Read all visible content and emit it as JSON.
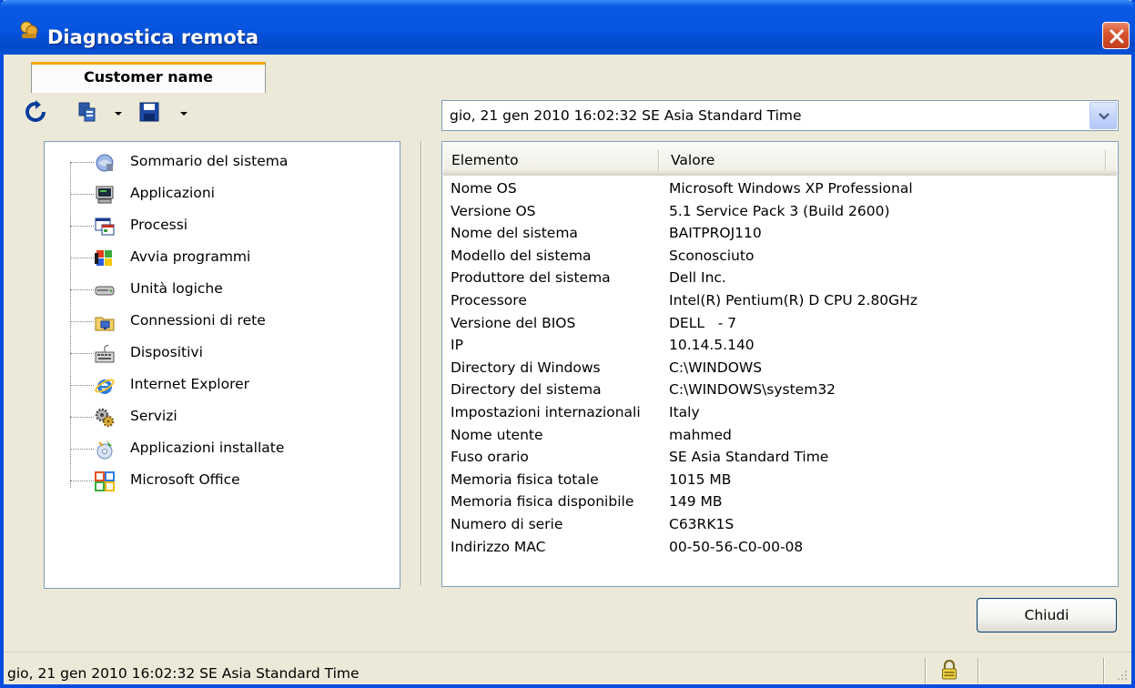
{
  "window": {
    "title": "Diagnostica remota",
    "close_label": "×"
  },
  "tab": {
    "label": "Customer name"
  },
  "toolbar": {
    "icons": [
      "refresh-icon",
      "copy-icon",
      "save-icon"
    ]
  },
  "tree": {
    "items": [
      {
        "label": "Sommario del sistema",
        "icon": "system-summary-icon"
      },
      {
        "label": "Applicazioni",
        "icon": "applications-icon"
      },
      {
        "label": "Processi",
        "icon": "processes-icon"
      },
      {
        "label": "Avvia programmi",
        "icon": "startup-programs-icon"
      },
      {
        "label": "Unità logiche",
        "icon": "logical-drives-icon"
      },
      {
        "label": "Connessioni di rete",
        "icon": "network-connections-icon"
      },
      {
        "label": "Dispositivi",
        "icon": "devices-icon"
      },
      {
        "label": "Internet Explorer",
        "icon": "internet-explorer-icon"
      },
      {
        "label": "Servizi",
        "icon": "services-icon"
      },
      {
        "label": "Applicazioni installate",
        "icon": "installed-apps-icon"
      },
      {
        "label": "Microsoft Office",
        "icon": "microsoft-office-icon"
      }
    ]
  },
  "date_select": {
    "value": "gio, 21 gen 2010 16:02:32 SE Asia Standard Time"
  },
  "list": {
    "headers": {
      "element": "Elemento",
      "value": "Valore"
    },
    "rows": [
      {
        "k": "Nome OS",
        "v": "Microsoft Windows XP Professional"
      },
      {
        "k": "Versione OS",
        "v": "5.1 Service Pack 3 (Build 2600)"
      },
      {
        "k": "Nome del sistema",
        "v": "BAITPROJ110"
      },
      {
        "k": "Modello del sistema",
        "v": "Sconosciuto"
      },
      {
        "k": "Produttore del sistema",
        "v": "Dell Inc."
      },
      {
        "k": "Processore",
        "v": "Intel(R) Pentium(R) D CPU 2.80GHz"
      },
      {
        "k": "Versione del BIOS",
        "v": "DELL   - 7"
      },
      {
        "k": "IP",
        "v": "10.14.5.140"
      },
      {
        "k": "Directory di Windows",
        "v": "C:\\WINDOWS"
      },
      {
        "k": "Directory del sistema",
        "v": "C:\\WINDOWS\\system32"
      },
      {
        "k": "Impostazioni internazionali",
        "v": "Italy"
      },
      {
        "k": "Nome utente",
        "v": "mahmed"
      },
      {
        "k": "Fuso orario",
        "v": "SE Asia Standard Time"
      },
      {
        "k": "Memoria fisica totale",
        "v": "1015 MB"
      },
      {
        "k": "Memoria fisica disponibile",
        "v": "149 MB"
      },
      {
        "k": "Numero di serie",
        "v": "C63RK1S"
      },
      {
        "k": "Indirizzo MAC",
        "v": "00-50-56-C0-00-08"
      }
    ]
  },
  "buttons": {
    "close_label": "Chiudi"
  },
  "statusbar": {
    "text": "gio, 21 gen 2010 16:02:32 SE Asia Standard Time"
  },
  "colors": {
    "titlebar": "#0654e0",
    "close": "#d9552e",
    "tab_accent": "#f6a800"
  }
}
